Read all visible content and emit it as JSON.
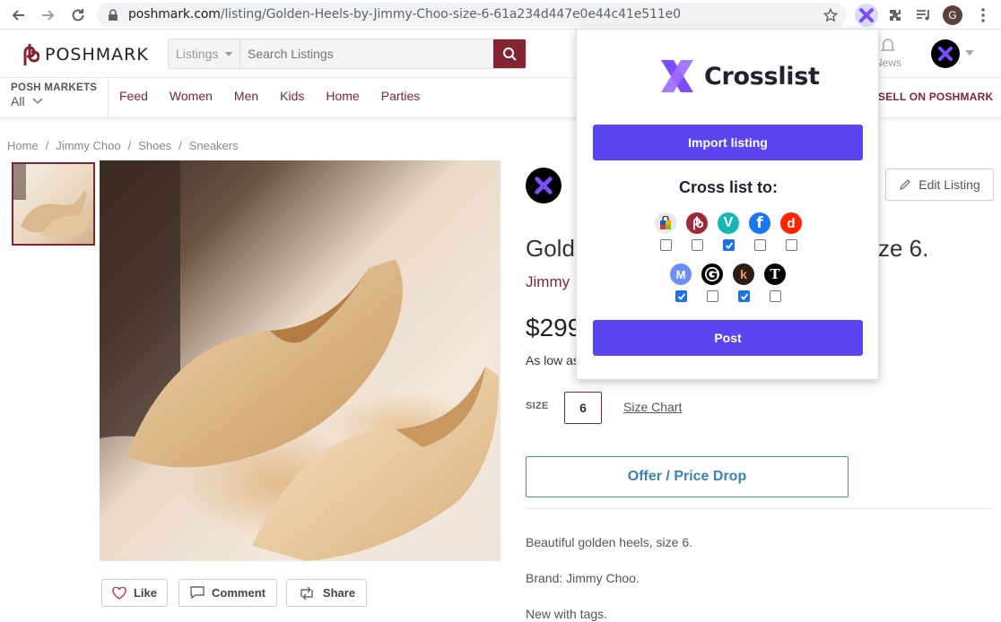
{
  "browser": {
    "url_host": "poshmark.com",
    "url_path": "/listing/Golden-Heels-by-Jimmy-Choo-size-6-61a234d447e0e44c41e511e0",
    "profile_initial": "G"
  },
  "header": {
    "logo_text": "POSHMARK",
    "search_category": "Listings",
    "search_placeholder": "Search Listings",
    "news_label": "News"
  },
  "catbar": {
    "markets_title": "POSH MARKETS",
    "markets_value": "All",
    "nav": [
      "Feed",
      "Women",
      "Men",
      "Kids",
      "Home",
      "Parties"
    ],
    "sell_label": "SELL ON POSHMARK"
  },
  "breadcrumb": [
    "Home",
    "Jimmy Choo",
    "Shoes",
    "Sneakers"
  ],
  "actions": {
    "like": "Like",
    "comment": "Comment",
    "share": "Share"
  },
  "listing": {
    "edit_label": "Edit Listing",
    "title_left": "Gold",
    "title_right": "ze 6.",
    "brand": "Jimmy",
    "price": "$299",
    "as_low_as": "As low as",
    "size_label": "SIZE",
    "size_value": "6",
    "size_chart": "Size Chart",
    "offer_label": "Offer / Price Drop",
    "description": [
      "Beautiful golden heels, size 6.",
      "Brand: Jimmy Choo.",
      "New with tags."
    ]
  },
  "crosslist": {
    "logo_text": "Crosslist",
    "import_label": "Import listing",
    "heading": "Cross list to:",
    "post_label": "Post",
    "row1": [
      {
        "name": "ebay",
        "checked": false
      },
      {
        "name": "poshmark",
        "checked": false
      },
      {
        "name": "vinted",
        "checked": true
      },
      {
        "name": "facebook",
        "checked": false
      },
      {
        "name": "depop",
        "checked": false
      }
    ],
    "row2": [
      {
        "name": "mercari",
        "checked": true
      },
      {
        "name": "grailed",
        "checked": false
      },
      {
        "name": "kidizen",
        "checked": true
      },
      {
        "name": "tradesy",
        "checked": false
      }
    ]
  },
  "colors": {
    "poshmark": "#822432",
    "crosslist_purple": "#5b45f0",
    "offer_blue": "#3b82b6"
  }
}
